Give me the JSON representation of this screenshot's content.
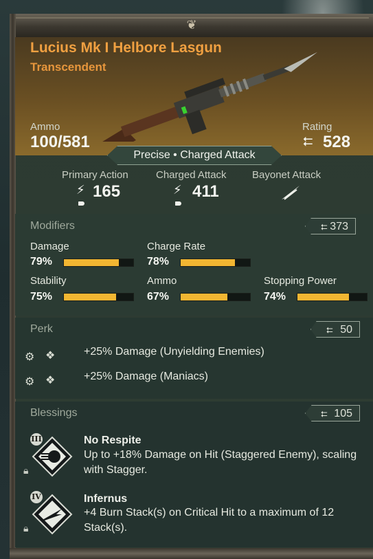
{
  "weapon": {
    "name": "Lucius Mk I Helbore Lasgun",
    "rarity": "Transcendent",
    "ammo_label": "Ammo",
    "ammo_value": "100/581",
    "rating_label": "Rating",
    "rating_value": "528",
    "attack_banner": "Precise • Charged Attack"
  },
  "actions": [
    {
      "name": "Primary Action",
      "value": "165"
    },
    {
      "name": "Charged Attack",
      "value": "411"
    },
    {
      "name": "Bayonet Attack",
      "value": ""
    }
  ],
  "modifiers": {
    "title": "Modifiers",
    "rating": "373",
    "stats": [
      {
        "name": "Damage",
        "value": "79%",
        "fill": 0.79
      },
      {
        "name": "Charge Rate",
        "value": "78%",
        "fill": 0.78
      },
      {
        "name": "Stability",
        "value": "75%",
        "fill": 0.75
      },
      {
        "name": "Ammo",
        "value": "67%",
        "fill": 0.67
      },
      {
        "name": "Stopping Power",
        "value": "74%",
        "fill": 0.74
      }
    ]
  },
  "perk": {
    "title": "Perk",
    "rating": "50",
    "items": [
      {
        "text": "+25% Damage (Unyielding Enemies)"
      },
      {
        "text": "+25% Damage (Maniacs)"
      }
    ]
  },
  "blessings": {
    "title": "Blessings",
    "rating": "105",
    "items": [
      {
        "tier": "III",
        "name": "No Respite",
        "desc": "Up to +18% Damage on Hit (Staggered Enemy), scaling with Stagger."
      },
      {
        "tier": "IV",
        "name": "Infernus",
        "desc": "+4 Burn Stack(s) on Critical Hit to a maximum of 12 Stack(s)."
      }
    ]
  },
  "colors": {
    "accent_orange": "#f0a041",
    "bar_fill": "#f2b632"
  }
}
